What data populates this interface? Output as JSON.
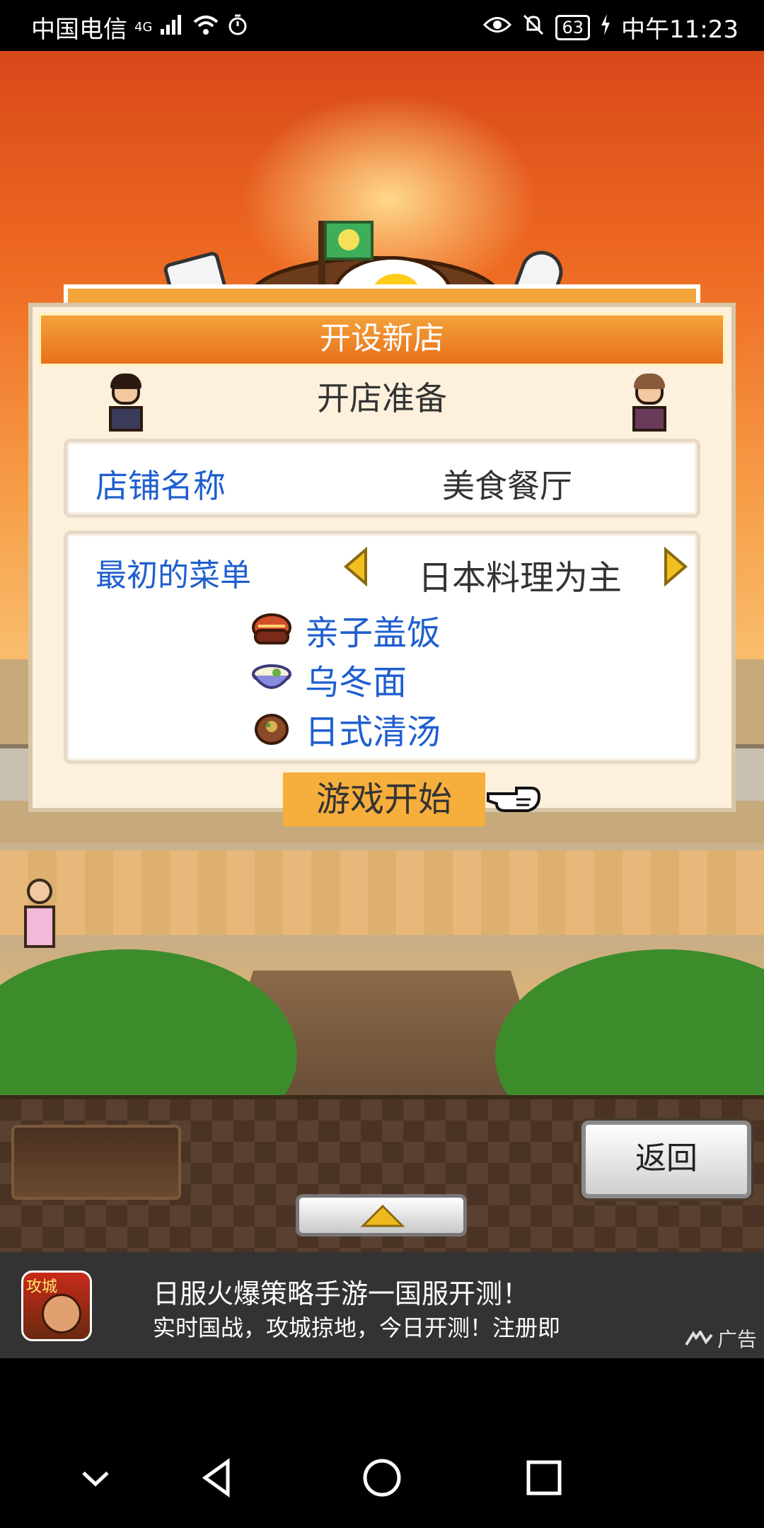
{
  "status_bar": {
    "carrier": "中国电信",
    "network": "4G",
    "battery": "63",
    "time": "中午11:23"
  },
  "dialog": {
    "title": "开设新店",
    "subtitle": "开店准备",
    "shop_name_label": "店铺名称",
    "shop_name_value": "美食餐厅",
    "menu_label": "最初的菜单",
    "menu_value": "日本料理为主",
    "dishes": [
      "亲子盖饭",
      "乌冬面",
      "日式清汤"
    ],
    "start_button": "游戏开始"
  },
  "bottom_bar": {
    "back_button": "返回"
  },
  "ad": {
    "icon_tag": "攻城",
    "title": "日服火爆策略手游一国服开测！",
    "description": "实时国战，攻城掠地，今日开测！注册即",
    "label": "广告"
  },
  "colors": {
    "dialog_title_orange": "#e8701c",
    "label_blue": "#1f5fcf",
    "start_button_orange": "#f6ae3c"
  }
}
